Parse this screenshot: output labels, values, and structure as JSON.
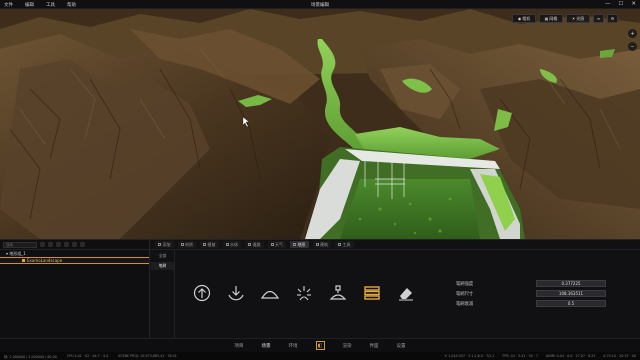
{
  "app": {
    "title": "场景编辑",
    "menu": [
      "文件",
      "编辑",
      "工具",
      "帮助"
    ],
    "window_controls": [
      "—",
      "☐",
      "✕"
    ]
  },
  "viewport": {
    "toolbar": [
      {
        "icon": "camera-icon",
        "label": "相机"
      },
      {
        "icon": "grid-icon",
        "label": "网格"
      },
      {
        "icon": "sun-icon",
        "label": "光照"
      },
      {
        "icon": "layers-icon",
        "label": ""
      },
      {
        "icon": "settings-icon",
        "label": ""
      }
    ],
    "side_tools": [
      "+",
      "−"
    ]
  },
  "outliner": {
    "search_placeholder": "搜索",
    "tree": [
      {
        "label": "▾ 地形组_1",
        "selected": false,
        "child": false
      },
      {
        "label": "ExamoLandscape",
        "selected": true,
        "child": true
      }
    ]
  },
  "editor": {
    "tabs": [
      {
        "label": "添加",
        "active": false
      },
      {
        "label": "材质",
        "active": false
      },
      {
        "label": "植被",
        "active": false
      },
      {
        "label": "水体",
        "active": false
      },
      {
        "label": "道路",
        "active": false
      },
      {
        "label": "天气",
        "active": false
      },
      {
        "label": "地形",
        "active": true
      },
      {
        "label": "建筑",
        "active": false
      },
      {
        "label": "工具",
        "active": false
      }
    ],
    "left_items": [
      {
        "label": "全部",
        "on": false
      },
      {
        "label": "笔刷",
        "on": true
      }
    ],
    "brushes": [
      {
        "name": "raise",
        "icon": "arrow-up-circle-icon",
        "active": false
      },
      {
        "name": "lower",
        "icon": "arrow-down-circle-icon",
        "active": false
      },
      {
        "name": "smooth",
        "icon": "hill-icon",
        "active": false
      },
      {
        "name": "noise",
        "icon": "sparkle-icon",
        "active": false
      },
      {
        "name": "flatten",
        "icon": "flatten-icon",
        "active": false
      },
      {
        "name": "terrace",
        "icon": "terrace-icon",
        "active": true
      },
      {
        "name": "erase",
        "icon": "eraser-icon",
        "active": false
      }
    ],
    "properties": [
      {
        "label": "笔刷强度",
        "value": "0.377225"
      },
      {
        "label": "笔刷尺寸",
        "value": "108.363511"
      },
      {
        "label": "笔刷衰减",
        "value": "0.5"
      }
    ]
  },
  "nav": {
    "items": [
      {
        "label": "项目",
        "active": false
      },
      {
        "label": "场景",
        "active": true
      },
      {
        "label": "环境",
        "active": false
      },
      {
        "label": "logo",
        "active": false
      },
      {
        "label": "渲染",
        "active": false
      },
      {
        "label": "界面",
        "active": false
      },
      {
        "label": "设置",
        "active": false
      }
    ]
  },
  "status": {
    "left": [
      "帧: 1 000000 / 1.000000 / 60.00",
      "CPU 4.01 · 02 · 04.7 · 4.4",
      "SCENE PROJ: 10,973,885,41 · 76.41"
    ],
    "right": [
      "Y: 1,044.557 · 2:1,2,6.0 · 7/2,1",
      "FPS: 44 · 3.41 · 30 · 7",
      "ANIM: 0.04 · 0.0 · 27,07 · 8.25",
      "0.75.10 · 20:37 · 00"
    ]
  },
  "colors": {
    "accent": "#d4911d",
    "terrain_brown": "#5c4226",
    "grass": "#7fc24a",
    "selected_tool": "#e0a93c"
  }
}
